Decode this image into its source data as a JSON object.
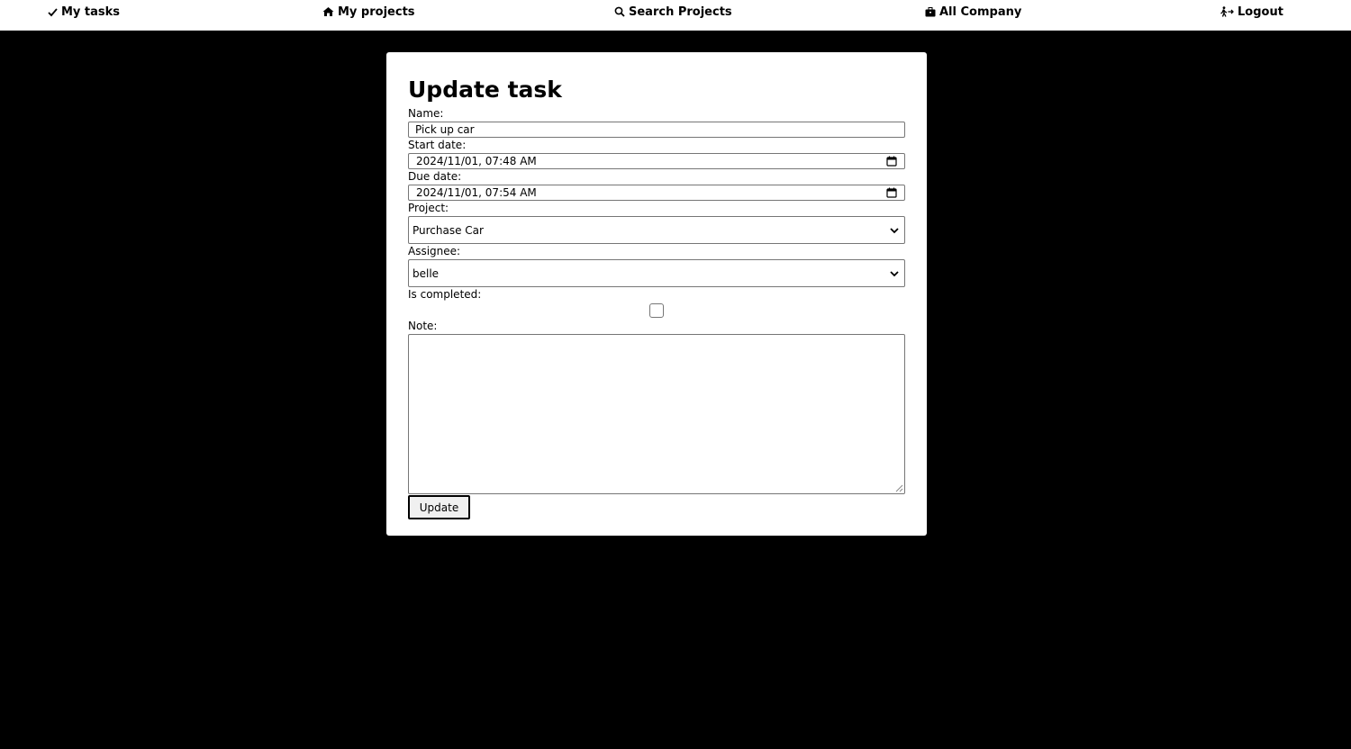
{
  "nav": {
    "my_tasks": "My tasks",
    "my_projects": "My projects",
    "search_projects": "Search Projects",
    "all_company": "All Company",
    "logout": "Logout"
  },
  "form": {
    "title": "Update task",
    "name_label": "Name:",
    "name_value": "Pick up car",
    "start_label": "Start date:",
    "start_value": "2024/11/01, 07:48 AM",
    "due_label": "Due date:",
    "due_value": "2024/11/01, 07:54 AM",
    "project_label": "Project:",
    "project_value": "Purchase Car",
    "assignee_label": "Assignee:",
    "assignee_value": "belle",
    "completed_label": "Is completed:",
    "completed_checked": false,
    "note_label": "Note:",
    "note_value": "",
    "submit_label": "Update"
  },
  "icons": {
    "my_tasks": "check-icon",
    "my_projects": "home-icon",
    "search_projects": "search-icon",
    "all_company": "briefcase-icon",
    "logout": "logout-icon"
  },
  "colors": {
    "background": "#000000",
    "card": "#ffffff",
    "navbar": "#ffffff"
  }
}
